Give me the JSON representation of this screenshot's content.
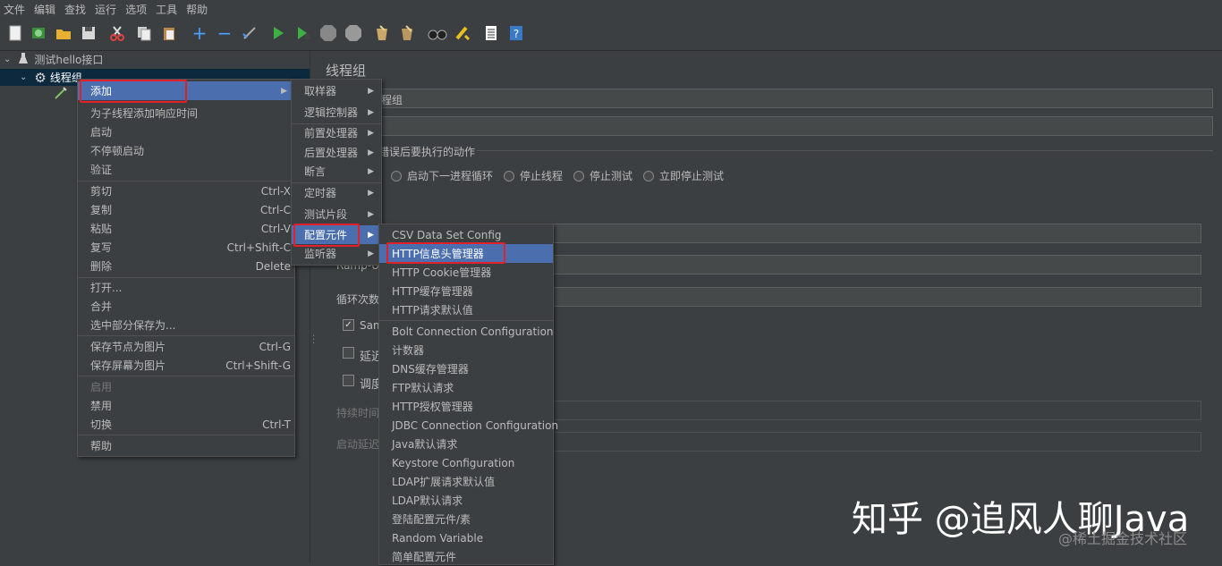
{
  "menubar": [
    "文件",
    "编辑",
    "查找",
    "运行",
    "选项",
    "工具",
    "帮助"
  ],
  "tree": {
    "root": "测试hello接口",
    "thread_group": "线程组"
  },
  "panel": {
    "title": "线程组",
    "name_value": "程组",
    "error_action_label": "错误后要执行的动作",
    "radios": [
      "启动下一进程循环",
      "停止线程",
      "停止测试",
      "立即停止测试"
    ],
    "ramp_label": "Ramp-U",
    "loop_label": "循环次数",
    "same_user_label": "Sam",
    "delay_label": "延迟",
    "scheduler_label": "调度",
    "duration_label": "持续时间",
    "startup_delay_label": "启动延迟"
  },
  "context_menu": {
    "add": "添加",
    "add_think_time": "为子线程添加响应时间",
    "start": "启动",
    "start_no_pause": "不停顿启动",
    "validate": "验证",
    "cut": "剪切",
    "cut_sc": "Ctrl-X",
    "copy": "复制",
    "copy_sc": "Ctrl-C",
    "paste": "粘贴",
    "paste_sc": "Ctrl-V",
    "duplicate": "复写",
    "duplicate_sc": "Ctrl+Shift-C",
    "delete": "删除",
    "delete_sc": "Delete",
    "open": "打开...",
    "merge": "合并",
    "save_selection": "选中部分保存为...",
    "save_node_image": "保存节点为图片",
    "save_node_image_sc": "Ctrl-G",
    "save_screen_image": "保存屏幕为图片",
    "save_screen_image_sc": "Ctrl+Shift-G",
    "enable": "启用",
    "disable": "禁用",
    "toggle": "切换",
    "toggle_sc": "Ctrl-T",
    "help": "帮助"
  },
  "add_menu": {
    "sampler": "取样器",
    "logic_controller": "逻辑控制器",
    "pre_processor": "前置处理器",
    "post_processor": "后置处理器",
    "assertion": "断言",
    "timer": "定时器",
    "test_fragment": "测试片段",
    "config_element": "配置元件",
    "listener": "监听器"
  },
  "config_menu": {
    "items": [
      "CSV Data Set Config",
      "HTTP信息头管理器",
      "HTTP Cookie管理器",
      "HTTP缓存管理器",
      "HTTP请求默认值",
      "Bolt Connection Configuration",
      "计数器",
      "DNS缓存管理器",
      "FTP默认请求",
      "HTTP授权管理器",
      "JDBC Connection Configuration",
      "Java默认请求",
      "Keystore Configuration",
      "LDAP扩展请求默认值",
      "LDAP默认请求",
      "登陆配置元件/素",
      "Random Variable",
      "简单配置元件"
    ]
  },
  "watermark": {
    "main": "知乎 @追风人聊Java",
    "sub": "@稀土掘金技术社区"
  },
  "colors": {
    "background": "#3c3f41",
    "selection": "#4b6eaf",
    "highlight_box": "#e0202a"
  }
}
